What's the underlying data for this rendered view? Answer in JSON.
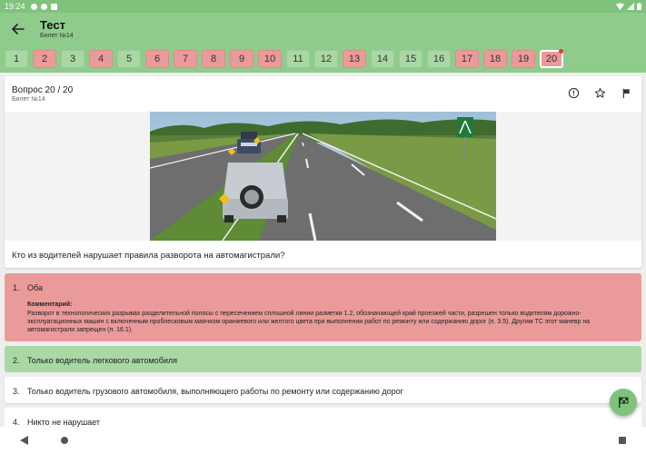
{
  "status_bar": {
    "time": "19:24"
  },
  "app_bar": {
    "title": "Тест",
    "subtitle": "Билет №14"
  },
  "tickets": [
    {
      "label": "1",
      "state": "neutral"
    },
    {
      "label": "2",
      "state": "wrong"
    },
    {
      "label": "3",
      "state": "neutral"
    },
    {
      "label": "4",
      "state": "wrong"
    },
    {
      "label": "5",
      "state": "neutral"
    },
    {
      "label": "6",
      "state": "wrong"
    },
    {
      "label": "7",
      "state": "wrong"
    },
    {
      "label": "8",
      "state": "wrong"
    },
    {
      "label": "9",
      "state": "wrong"
    },
    {
      "label": "10",
      "state": "wrong"
    },
    {
      "label": "11",
      "state": "neutral"
    },
    {
      "label": "12",
      "state": "neutral"
    },
    {
      "label": "13",
      "state": "wrong"
    },
    {
      "label": "14",
      "state": "neutral"
    },
    {
      "label": "15",
      "state": "neutral"
    },
    {
      "label": "16",
      "state": "neutral"
    },
    {
      "label": "17",
      "state": "wrong"
    },
    {
      "label": "18",
      "state": "wrong"
    },
    {
      "label": "19",
      "state": "wrong"
    },
    {
      "label": "20",
      "state": "current"
    }
  ],
  "question": {
    "title": "Вопрос 20 / 20",
    "subtitle": "Билет №14",
    "text": "Кто из водителей нарушает правила разворота на автомагистрали?"
  },
  "answers": [
    {
      "num": "1.",
      "text": "Оба",
      "comment_label": "Комментарий:",
      "comment": "Разворот в технологических разрывах разделительной полосы с пересечением сплошной линии разметки 1.2, обозначающей край проезжей части, разрешен только водителям дорожно-эксплуатационных машин с включенным проблесковым маячком оранжевого или желтого цвета при выполнении работ по ремонту или содержанию дорог (п. 3.5). Другим ТС этот маневр на автомагистрали запрещен (п. 16.1)."
    },
    {
      "num": "2.",
      "text": "Только водитель легкового автомобиля"
    },
    {
      "num": "3.",
      "text": "Только водитель грузового автомобиля, выполняющего работы по ремонту или содержанию дорог"
    },
    {
      "num": "4.",
      "text": "Никто не нарушает"
    }
  ],
  "colors": {
    "primary": "#8fcc8b",
    "status_bar": "#7fc27c",
    "wrong": "#eb9a9a",
    "correct": "#a9d8a5",
    "badge_dot": "#e23a3a"
  },
  "icons": {
    "back": "arrow-back-icon",
    "info": "info-icon",
    "favorite": "star-outline-icon",
    "report": "flag-icon",
    "finish": "flag-finish-icon"
  }
}
